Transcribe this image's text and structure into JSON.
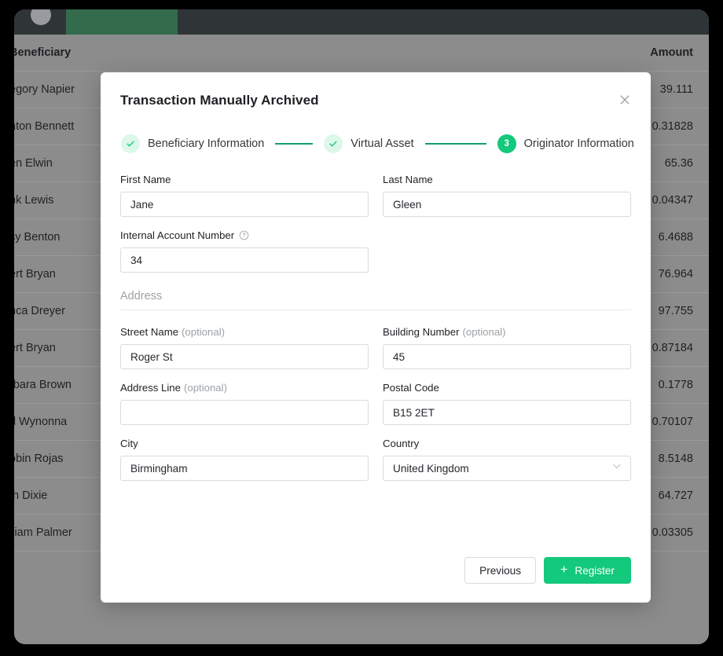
{
  "navbar": {
    "logo_icon": "circle-logo-icon",
    "active_tab_label": ""
  },
  "background_table": {
    "columns": [
      "Beneficiary",
      "Amount"
    ],
    "rows": [
      {
        "beneficiary": "egory Napier",
        "amount": "39.111"
      },
      {
        "beneficiary": "nton Bennett",
        "amount": "0.31828"
      },
      {
        "beneficiary": "en Elwin",
        "amount": "65.36"
      },
      {
        "beneficiary": "nk Lewis",
        "amount": "0.04347"
      },
      {
        "beneficiary": "sy Benton",
        "amount": "6.4688"
      },
      {
        "beneficiary": "ert Bryan",
        "amount": "76.964"
      },
      {
        "beneficiary": "nca Dreyer",
        "amount": "97.755"
      },
      {
        "beneficiary": "ert Bryan",
        "amount": "0.87184"
      },
      {
        "beneficiary": "rbara Brown",
        "amount": "0.1778"
      },
      {
        "beneficiary": "rl Wynonna",
        "amount": "0.70107"
      },
      {
        "beneficiary": "obin Rojas",
        "amount": "8.5148"
      },
      {
        "beneficiary": "th Dixie",
        "amount": "64.727"
      },
      {
        "beneficiary": "lliam Palmer",
        "amount": "0.03305"
      }
    ]
  },
  "modal": {
    "title": "Transaction Manually Archived",
    "close_icon": "close-icon",
    "stepper": {
      "steps": [
        {
          "label": "Beneficiary Information",
          "state": "done",
          "marker": "✓"
        },
        {
          "label": "Virtual Asset",
          "state": "done",
          "marker": "✓"
        },
        {
          "label": "Originator Information",
          "state": "current",
          "marker": "3"
        }
      ]
    },
    "fields": {
      "first_name": {
        "label": "First Name",
        "value": "Jane",
        "placeholder": ""
      },
      "last_name": {
        "label": "Last Name",
        "value": "Gleen",
        "placeholder": ""
      },
      "internal_account": {
        "label": "Internal Account Number",
        "value": "34",
        "placeholder": "",
        "help_icon": "help-circle-icon"
      },
      "street_name": {
        "label": "Street Name",
        "optional": "(optional)",
        "value": "Roger St",
        "placeholder": ""
      },
      "building_number": {
        "label": "Building Number",
        "optional": "(optional)",
        "value": "45",
        "placeholder": ""
      },
      "address_line": {
        "label": "Address Line",
        "optional": "(optional)",
        "value": "",
        "placeholder": ""
      },
      "postal_code": {
        "label": "Postal Code",
        "value": "B15 2ET",
        "placeholder": ""
      },
      "city": {
        "label": "City",
        "value": "Birmingham",
        "placeholder": ""
      },
      "country": {
        "label": "Country",
        "value": "United Kingdom",
        "placeholder": "",
        "chevron_icon": "chevron-down-icon"
      }
    },
    "section_address_title": "Address",
    "footer": {
      "previous_label": "Previous",
      "register_label": "Register",
      "register_icon": "plus-icon"
    }
  },
  "colors": {
    "accent_green": "#13c97c",
    "nav_tab_green": "#336b4c",
    "navbar_dark": "#2f3437",
    "overlay_gray": "#8c8c8c",
    "step_line": "#13a06f",
    "chip_orange": "#c0700f"
  }
}
